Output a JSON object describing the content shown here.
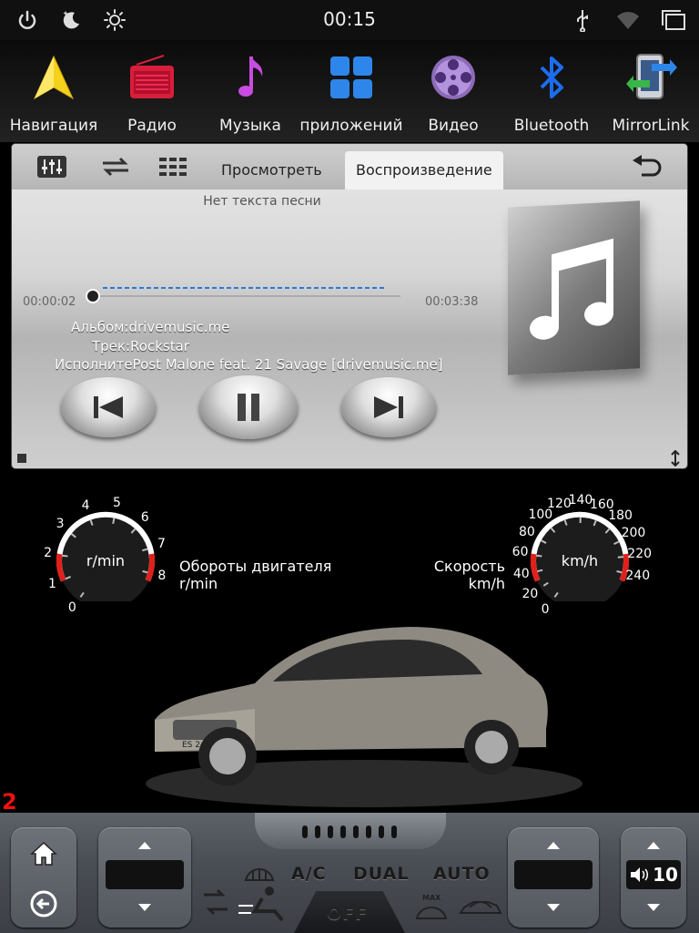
{
  "status_bar": {
    "time": "00:15"
  },
  "dock": {
    "items": [
      {
        "label": "Навигация",
        "icon": "navigation-arrow-icon"
      },
      {
        "label": "Радио",
        "icon": "radio-icon"
      },
      {
        "label": "Музыка",
        "icon": "music-note-icon"
      },
      {
        "label": "приложений",
        "icon": "apps-grid-icon"
      },
      {
        "label": "Видео",
        "icon": "film-reel-icon"
      },
      {
        "label": "Bluetooth",
        "icon": "bluetooth-icon"
      },
      {
        "label": "MirrorLink",
        "icon": "mirrorlink-icon"
      }
    ]
  },
  "player": {
    "tabs": [
      "Просмотреть",
      "Воспроизведение"
    ],
    "active_tab": "Воспроизведение",
    "lyrics": "Нет текста песни",
    "time_current": "00:00:02",
    "time_total": "00:03:38",
    "album": "Альбом:drivemusic.me",
    "track": "Трек:Rockstar",
    "artist": "ИсполнитеPost Malone feat. 21 Savage [drivemusic.me]"
  },
  "gauges": {
    "rpm": {
      "unit": "r/min",
      "label_line1": "Обороты двигателя",
      "label_line2": "r/min",
      "ticks": [
        "0",
        "1",
        "2",
        "3",
        "4",
        "5",
        "6",
        "7",
        "8"
      ],
      "value": 0
    },
    "speed": {
      "unit": "km/h",
      "label_line1": "Скорость",
      "label_line2": "km/h",
      "ticks": [
        "0",
        "20",
        "40",
        "60",
        "80",
        "100",
        "120",
        "140",
        "160",
        "180",
        "200",
        "220",
        "240"
      ],
      "value": 0
    }
  },
  "car": {
    "plate": "ES 240"
  },
  "marker": "2",
  "climate": {
    "ac": "A/C",
    "dual": "DUAL",
    "auto": "AUTO",
    "off": "OFF",
    "max": "MAX",
    "volume": "10"
  },
  "colors": {
    "accent_blue": "#2a7ad8",
    "gauge_red": "#e0201a",
    "marker_red": "#e11111"
  }
}
